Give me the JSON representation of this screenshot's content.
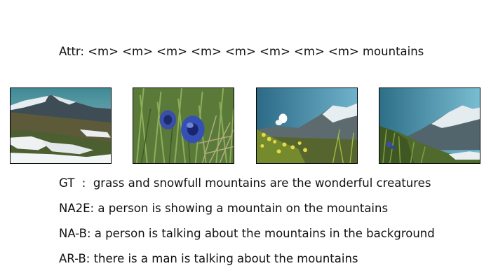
{
  "attr_line": "Attr: <m> <m> <m> <m> <m> <m> <m> <m> mountains",
  "captions": {
    "gt": "GT  :  grass and snowfull mountains are the wonderful creatures",
    "na2e": "NA2E: a person is showing a mountain on the mountains",
    "na_b": "NA-B: a person is talking about the mountains in the background",
    "ar_b": "AR-B: there is a man is talking about the mountains"
  }
}
